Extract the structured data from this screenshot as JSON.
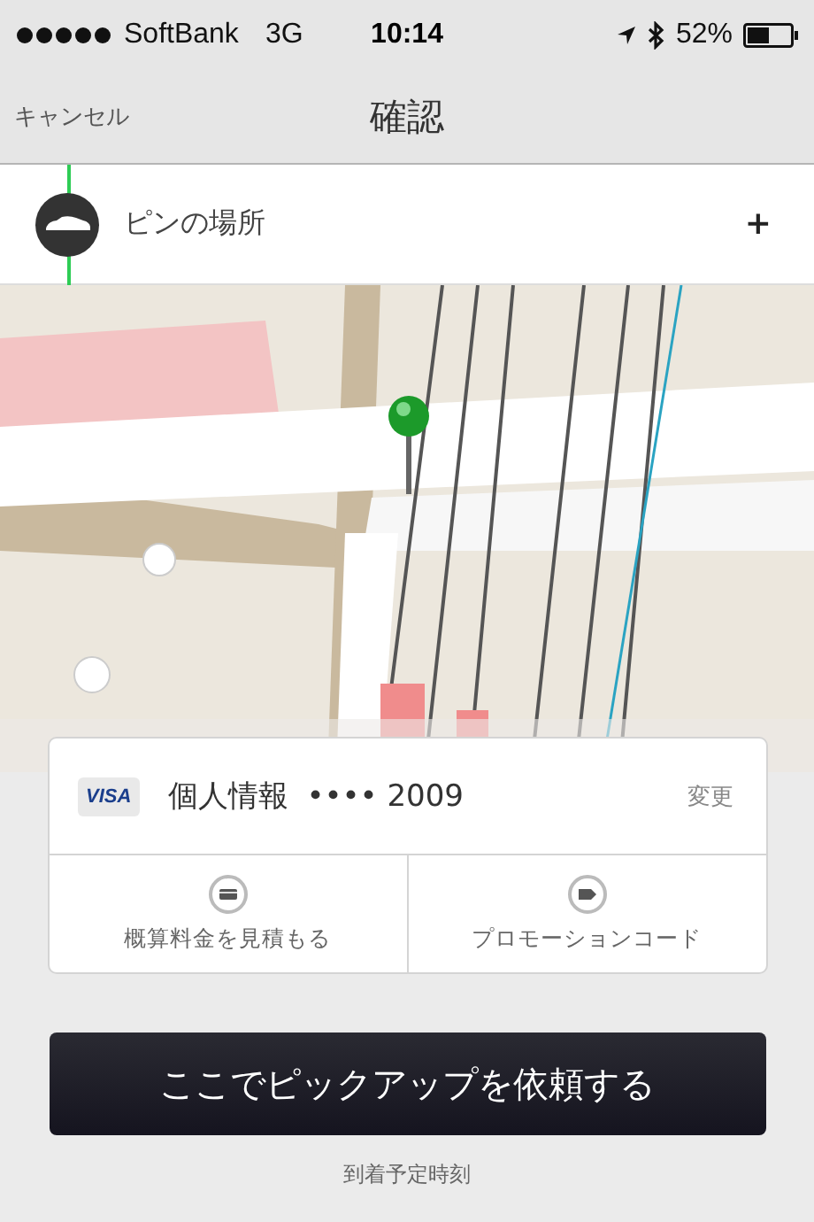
{
  "status_bar": {
    "carrier": "SoftBank",
    "network": "3G",
    "time": "10:14",
    "battery": "52%"
  },
  "nav": {
    "cancel": "キャンセル",
    "title": "確認"
  },
  "pickup": {
    "label": "ピンの場所",
    "action": "+"
  },
  "payment": {
    "brand": "VISA",
    "label": "個人情報",
    "number": "•••• 2009",
    "change": "変更"
  },
  "actions": [
    {
      "kind": "fare",
      "label": "概算料金を見積もる"
    },
    {
      "kind": "promo",
      "label": "プロモーションコード"
    }
  ],
  "request_button": "ここでピックアップを依頼する",
  "eta": "到着予定時刻"
}
